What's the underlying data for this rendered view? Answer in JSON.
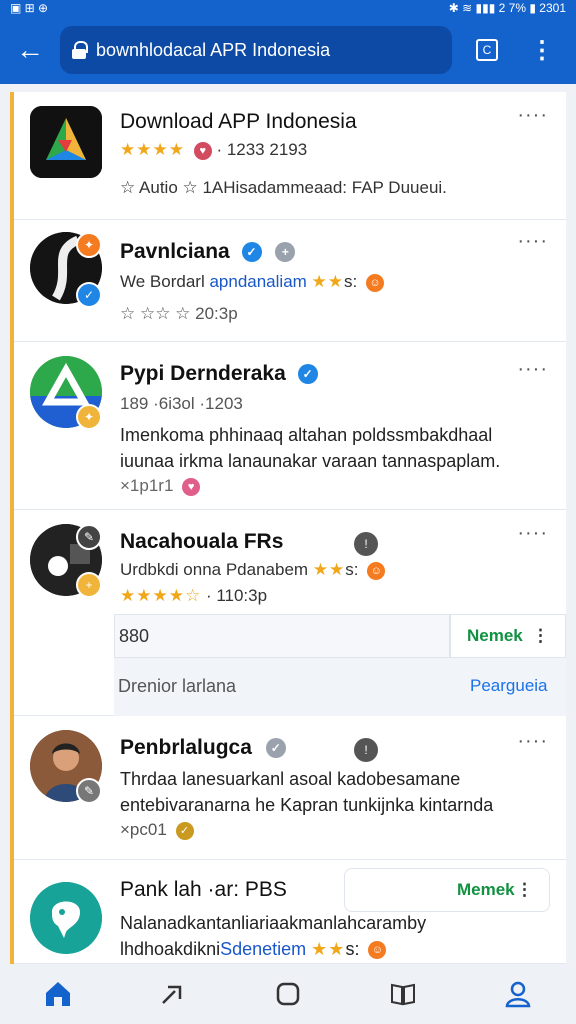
{
  "status": {
    "left": "▣ ⊞ ⊕",
    "right": "✱ ≋ ▮▮▮ 2 7% ▮ 2301"
  },
  "toolbar": {
    "back_label": "←",
    "url_text": "bownhlodacal APR Indonesia",
    "tab_label": "C",
    "menu_label": "⋮"
  },
  "feed": [
    {
      "title": "Download APP Indonesia",
      "stars": "★★★★",
      "rating_text": "· 1233 2193",
      "sub_line": "☆ Autio ☆ 1AHisadammeaad: FAP Duueui.",
      "more": "····"
    },
    {
      "title": "Pavnlciana",
      "meta_line": "We Bordarl",
      "meta_link": "apndanaliam",
      "meta_stars": "★★",
      "meta_tail": "s:",
      "sub_line": "☆ ☆☆ ☆ 20:3p",
      "more": "····"
    },
    {
      "title": "Pypi Dernderaka",
      "sub_line": "189 ·6i3ol ·1203",
      "body": "Imenkoma phhinaaq altahan poldssmbakdhaal iuunaa irkma lanaunakar varaan tannaspaplam.",
      "tail": "×1p1r1",
      "more": "····"
    },
    {
      "title": "Nacahouala FRs",
      "meta_line": "Urdbkdi onna Pdanabem",
      "meta_stars": "★★",
      "meta_tail": "s:",
      "rating_stars": "★★★★☆",
      "rating_text": "· 110:3p",
      "reply_value": "880",
      "action_label": "Nemek",
      "footer_text": "Drenior larlana",
      "footer_link": "Peargueia",
      "more": "····"
    },
    {
      "title": "Penbrlalugca",
      "body": "Thrdaa lanesuarkanl asoal kadobesamane entebivaranarna he Kapran tunkijnka kintarnda",
      "tail": "×pc01",
      "more": "····"
    },
    {
      "title": "Pank lah ·ar: PBS",
      "action_label": "Memek",
      "body_plain": "Nalanadkantanliariaakmanlahcaramby",
      "body_pre": "lhdhoakdikni",
      "body_link": "Sdenetiem",
      "body_stars": "★★",
      "body_tail": "s:"
    }
  ],
  "icon_colors": {
    "brand_blue": "#1463cc",
    "accent_blue": "#1f86e6",
    "action_green": "#129142",
    "star_gold": "#f0a71a",
    "accent_orange": "#f47b20"
  }
}
